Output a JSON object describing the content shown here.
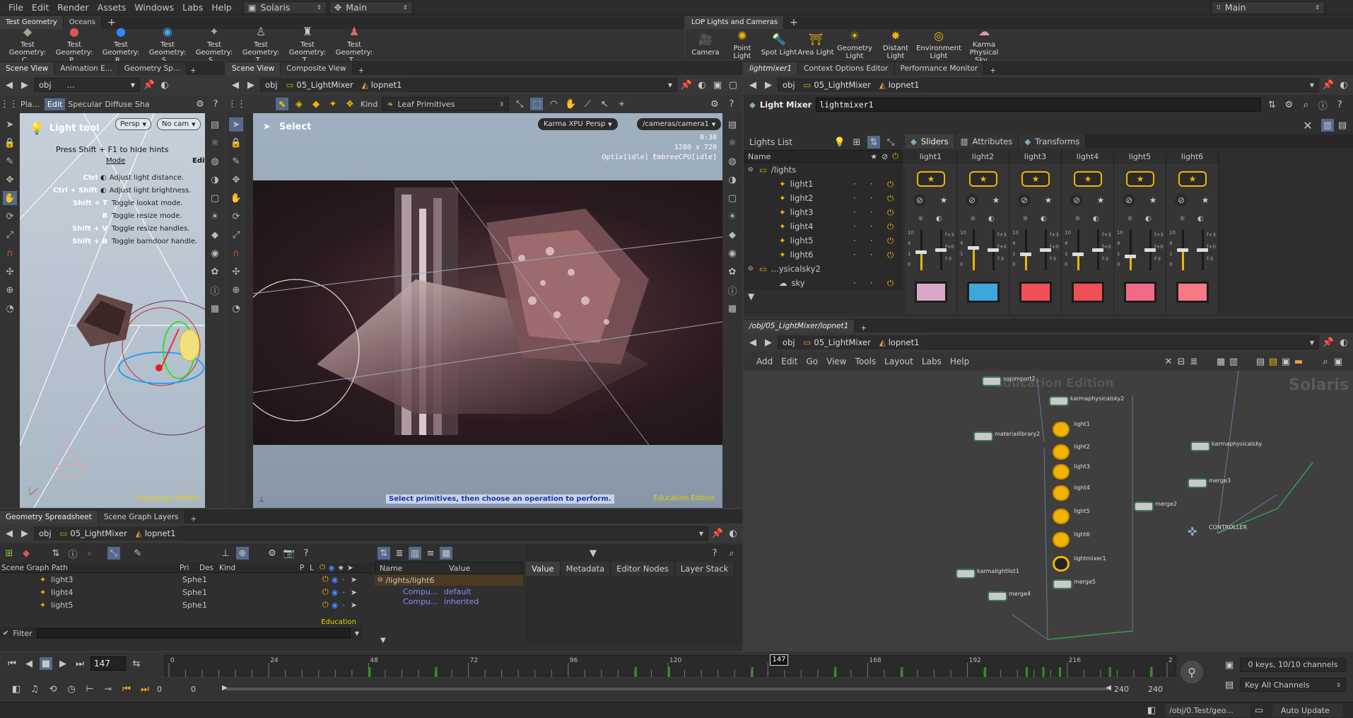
{
  "menubar": {
    "items": [
      "File",
      "Edit",
      "Render",
      "Assets",
      "Windows",
      "Labs",
      "Help"
    ],
    "desktop": "Solaris",
    "network": "Main",
    "right_desktop": "Main"
  },
  "shelf_left": {
    "tabs": [
      "Test Geometry",
      "Oceans"
    ],
    "tools": [
      "Test Geometry: C...",
      "Test Geometry: P...",
      "Test Geometry: R...",
      "Test Geometry: S...",
      "Test Geometry: S...",
      "Test Geometry: T...",
      "Test Geometry: T...",
      "Test Geometry: T..."
    ]
  },
  "shelf_right": {
    "tabs": [
      "LOP Lights and Cameras"
    ],
    "tools": [
      "Camera",
      "Point Light",
      "Spot Light",
      "Area Light",
      "Geometry Light",
      "Distant Light",
      "Environment Light",
      "Karma Physical Sky..."
    ]
  },
  "left_viewer": {
    "tabs": [
      "Scene View",
      "Animation E...",
      "Geometry Sp..."
    ],
    "path": [
      "obj",
      "..."
    ],
    "modes": [
      "Pla...",
      "Edit",
      "Specular",
      "Diffuse",
      "Sha"
    ],
    "tool_title": "Light tool",
    "persp": "Persp",
    "cam": "No cam",
    "hint_line": "Press Shift + F1 to hide hints",
    "mode_label": "Mode",
    "edit_label": "Edit",
    "hints": [
      {
        "keys": "Ctrl",
        "text": "Adjust light distance."
      },
      {
        "keys": "Ctrl + Shift",
        "text": "Adjust light brightness."
      },
      {
        "keys": "Shift + T",
        "text": "Toggle lookat mode."
      },
      {
        "keys": "B",
        "text": "Toggle resize mode."
      },
      {
        "keys": "Shift + V",
        "text": "Toggle resize handles."
      },
      {
        "keys": "Shift + B",
        "text": "Toggle barndoor handle."
      }
    ],
    "edu": "Education Edition"
  },
  "main_viewer": {
    "tabs": [
      "Scene View",
      "Composite View"
    ],
    "path": [
      "obj",
      "05_LightMixer",
      "lopnet1"
    ],
    "kind_label": "Kind",
    "kind_value": "Leaf Primitives",
    "select_title": "Select",
    "renderer": "Karma XPU",
    "persp": "Persp",
    "camera": "/cameras/camera1",
    "stats": [
      "0:38",
      "1280 x 720",
      "Optix[idle] EmbreeCPU[idle]"
    ],
    "status": "Select primitives, then choose an operation to perform.",
    "edu": "Education Edition"
  },
  "light_mixer": {
    "tabs": [
      "lightmixer1",
      "Context Options Editor",
      "Performance Monitor"
    ],
    "path": [
      "obj",
      "05_LightMixer",
      "lopnet1"
    ],
    "node_type": "Light Mixer",
    "node_name": "lightmixer1",
    "lights_list_label": "Lights List",
    "columns": [
      "Name"
    ],
    "tree": [
      {
        "label": "/lights",
        "level": 0,
        "type": "folder"
      },
      {
        "label": "light1",
        "level": 1,
        "type": "light"
      },
      {
        "label": "light2",
        "level": 1,
        "type": "light"
      },
      {
        "label": "light3",
        "level": 1,
        "type": "light"
      },
      {
        "label": "light4",
        "level": 1,
        "type": "light"
      },
      {
        "label": "light5",
        "level": 1,
        "type": "light"
      },
      {
        "label": "light6",
        "level": 1,
        "type": "light"
      },
      {
        "label": "...ysicalsky2",
        "level": 0,
        "type": "folder"
      },
      {
        "label": "sky",
        "level": 1,
        "type": "sky"
      }
    ],
    "mix_tabs": [
      "Sliders",
      "Attributes",
      "Transforms"
    ],
    "channels": [
      {
        "name": "light1",
        "color": "#d9a8c6",
        "level": 0.45
      },
      {
        "name": "light2",
        "color": "#3ea6dc",
        "level": 0.55
      },
      {
        "name": "light3",
        "color": "#f05055",
        "level": 0.4
      },
      {
        "name": "light4",
        "color": "#f05055",
        "level": 0.4
      },
      {
        "name": "light5",
        "color": "#f06a85",
        "level": 0.35
      },
      {
        "name": "light6",
        "color": "#f57a85",
        "level": 0.5
      }
    ],
    "fader_ticks": [
      "10",
      "4",
      "1",
      "0"
    ],
    "fader_marks": [
      "f+3",
      "f+0",
      "f-3"
    ]
  },
  "network": {
    "tab": "/obj/05_LightMixer/lopnet1",
    "path": [
      "obj",
      "05_LightMixer",
      "lopnet1"
    ],
    "menu": [
      "Add",
      "Edit",
      "Go",
      "View",
      "Tools",
      "Layout",
      "Labs",
      "Help"
    ],
    "watermark_left": "Education Edition",
    "watermark_right": "Solaris",
    "nodes": [
      "sopimport2",
      "materiallibrary2",
      "karmaphysicalsky2",
      "light1",
      "light2",
      "light3",
      "light4",
      "light5",
      "light6",
      "lightmixer1",
      "merge3",
      "merge2",
      "karmalightlist1",
      "merge4",
      "karmaphysicalsky",
      "merge5",
      "CONTROLLER"
    ]
  },
  "spreadsheet": {
    "tabs": [
      "Geometry Spreadsheet",
      "Scene Graph Layers"
    ],
    "path": [
      "obj",
      "05_LightMixer",
      "lopnet1"
    ],
    "columns": [
      "Scene Graph Path",
      "Pri",
      "Des",
      "Kind",
      "P",
      "L"
    ],
    "rows": [
      {
        "name": "light3",
        "pri": "Sphe",
        "des": "1"
      },
      {
        "name": "light4",
        "pri": "Sphe",
        "des": "1"
      },
      {
        "name": "light5",
        "pri": "Sphe",
        "des": "1"
      }
    ],
    "edu": "Education",
    "filter": "Filter",
    "prop_columns": [
      "Name",
      "Value"
    ],
    "prop_path": "/lights/light6",
    "prop_rows": [
      {
        "name": "Compu...",
        "value": "default"
      },
      {
        "name": "Compu...",
        "value": "inherited"
      }
    ],
    "value_tabs": [
      "Value",
      "Metadata",
      "Editor Nodes",
      "Layer Stack"
    ]
  },
  "timeline": {
    "frame": "147",
    "ticks": [
      "0",
      "24",
      "48",
      "72",
      "96",
      "120",
      "147",
      "168",
      "192",
      "216",
      "2"
    ],
    "start": "0",
    "start2": "0",
    "end": "240",
    "end2": "240",
    "keys_info": "0 keys, 10/10 channels",
    "key_all": "Key All Channels",
    "status_path": "/obj/0.Test/geo...",
    "auto_update": "Auto Update"
  }
}
